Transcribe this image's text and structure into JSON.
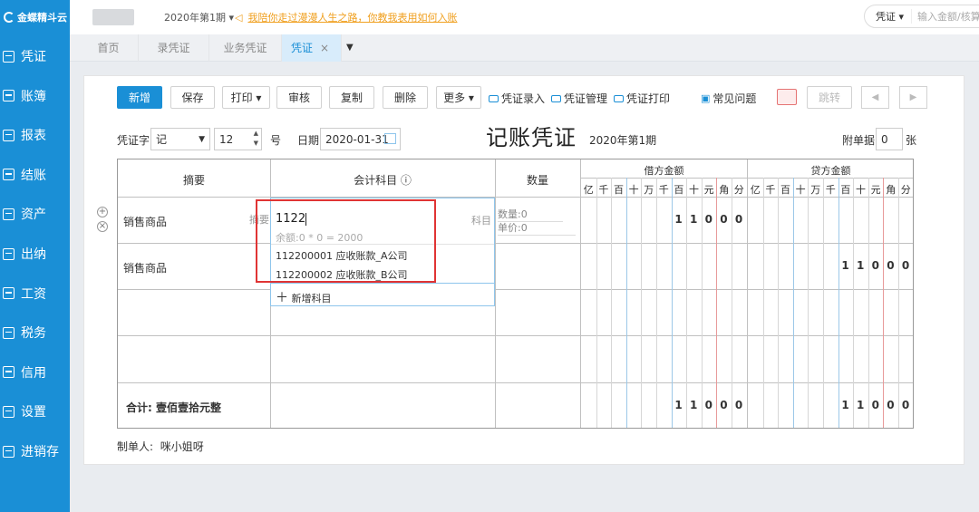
{
  "brand": {
    "name": "金蝶精斗云"
  },
  "sidebar": {
    "items": [
      {
        "label": "凭证",
        "icon": "voucher-icon"
      },
      {
        "label": "账簿",
        "icon": "ledger-icon"
      },
      {
        "label": "报表",
        "icon": "report-icon"
      },
      {
        "label": "结账",
        "icon": "checkout-icon"
      },
      {
        "label": "资产",
        "icon": "asset-icon"
      },
      {
        "label": "出纳",
        "icon": "cashier-icon"
      },
      {
        "label": "工资",
        "icon": "salary-icon"
      },
      {
        "label": "税务",
        "icon": "tax-icon"
      },
      {
        "label": "信用",
        "icon": "credit-icon"
      },
      {
        "label": "设置",
        "icon": "gear-icon"
      },
      {
        "label": "进销存",
        "icon": "inventory-icon"
      }
    ]
  },
  "topbar": {
    "period": "2020年第1期",
    "notice": "我陪你走过漫漫人生之路，你教我表用如何入账",
    "search_type": "凭证",
    "search_placeholder": "输入金额/核算"
  },
  "tabs": [
    {
      "label": "首页"
    },
    {
      "label": "录凭证"
    },
    {
      "label": "业务凭证"
    },
    {
      "label": "凭证"
    }
  ],
  "toolbar": {
    "new": "新增",
    "save": "保存",
    "print": "打印",
    "audit": "审核",
    "copy": "复制",
    "delete": "删除",
    "more": "更多",
    "entry": "凭证录入",
    "manage": "凭证管理",
    "print_voucher": "凭证打印",
    "faq": "常见问题",
    "jump": "跳转"
  },
  "voucher": {
    "word_label": "凭证字",
    "word": "记",
    "number": "12",
    "number_suffix": "号",
    "date_label": "日期",
    "date": "2020-01-31",
    "title": "记账凭证",
    "period": "2020年第1期",
    "attach_label": "附单据",
    "attach": "0",
    "attach_suffix": "张",
    "maker_label": "制单人:",
    "maker": "咪小姐呀"
  },
  "table": {
    "headers": {
      "summary": "摘要",
      "account": "会计科目",
      "qty": "数量",
      "debit": "借方金额",
      "credit": "贷方金额"
    },
    "units": [
      "亿",
      "千",
      "百",
      "十",
      "万",
      "千",
      "百",
      "十",
      "元",
      "角",
      "分"
    ],
    "rows": [
      {
        "summary": "销售商品",
        "summary_hint": "摘要",
        "account_input": "1122",
        "account_hint": "科目",
        "qty_label": "数量:",
        "qty": "0",
        "price_label": "单价:",
        "price": "0",
        "debit": "11000",
        "credit": ""
      },
      {
        "summary": "销售商品",
        "account_input": "",
        "debit": "",
        "credit": "11000"
      }
    ],
    "total_label": "合计: 壹佰壹拾元整",
    "total_debit": "11000",
    "total_credit": "11000"
  },
  "autocomplete": {
    "balance": "余额:0 * 0 = 2000",
    "options": [
      "112200001 应收账款_A公司",
      "112200002 应收账款_B公司"
    ],
    "add_new": "新增科目"
  },
  "colors": {
    "accent": "#1a8fd6",
    "highlight": "#e03434",
    "notice": "#f0a020"
  }
}
